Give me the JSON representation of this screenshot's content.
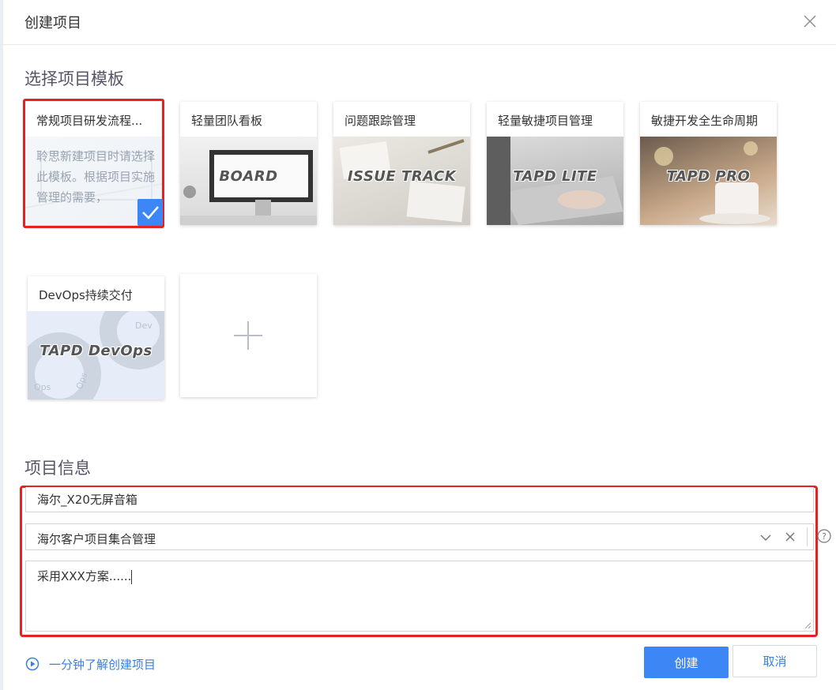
{
  "dialog": {
    "title": "创建项目"
  },
  "templates_section": {
    "heading": "选择项目模板",
    "templates": [
      {
        "name": "常规项目研发流程...",
        "description": "聆思新建项目时请选择此模板。根据项目实施管理的需要，",
        "selected": true
      },
      {
        "name": "轻量团队看板",
        "image_text": "BOARD"
      },
      {
        "name": "问题跟踪管理",
        "image_text": "ISSUE TRACK"
      },
      {
        "name": "轻量敏捷项目管理",
        "image_text": "TAPD LITE"
      },
      {
        "name": "敏捷开发全生命周期",
        "image_text": "TAPD PRO"
      },
      {
        "name": "DevOps持续交付",
        "image_text": "TAPD DevOps",
        "decor_texts": [
          "Dev",
          "Ops",
          "Ops"
        ]
      }
    ],
    "add_template_icon": "plus-icon"
  },
  "info_section": {
    "heading": "项目信息",
    "project_name_value": "海尔_X20无屏音箱",
    "project_set_value": "海尔客户项目集合管理",
    "description_value": "采用XXX方案......"
  },
  "footer": {
    "help_link": "一分钟了解创建项目",
    "create_label": "创建",
    "cancel_label": "取消"
  },
  "colors": {
    "accent": "#3c86f5",
    "highlight_border": "#e52222"
  }
}
